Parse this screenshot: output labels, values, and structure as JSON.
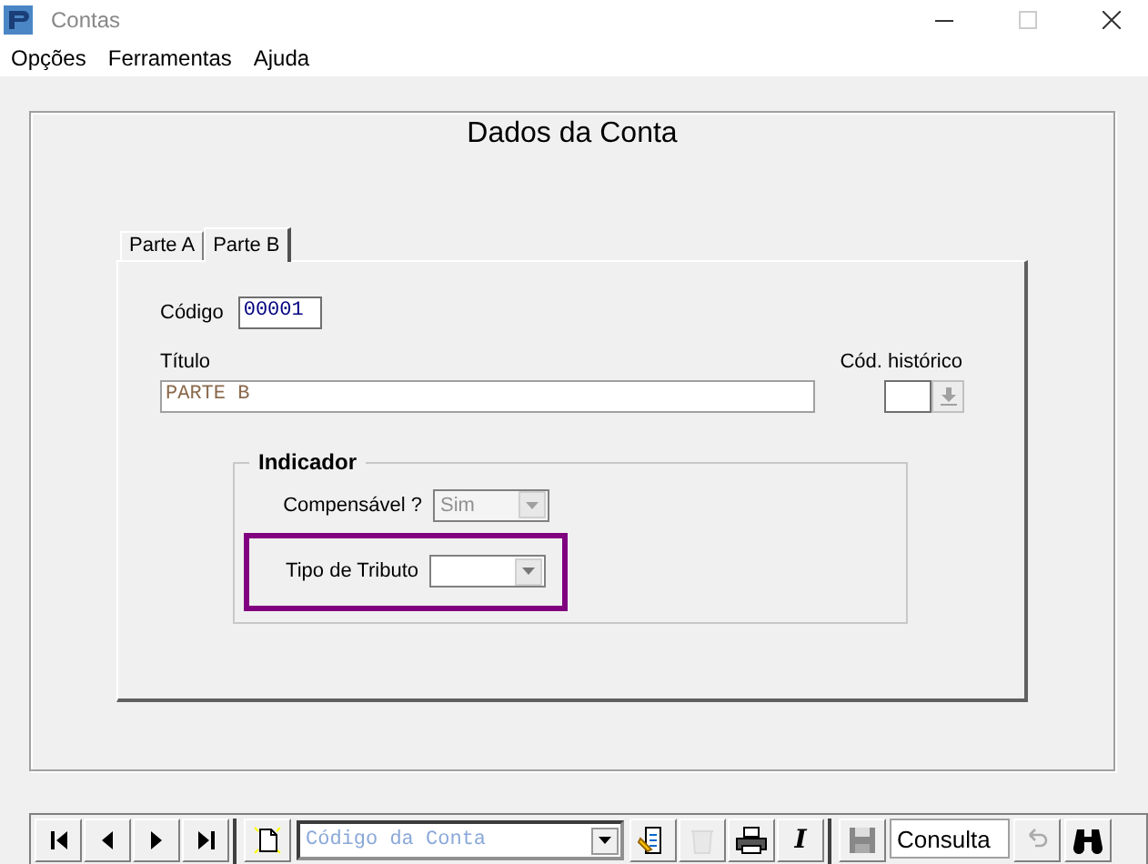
{
  "window": {
    "title": "Contas"
  },
  "menu": [
    "Opções",
    "Ferramentas",
    "Ajuda"
  ],
  "panel": {
    "title": "Dados da Conta"
  },
  "tabs": [
    {
      "label": "Parte A",
      "selected": false
    },
    {
      "label": "Parte B",
      "selected": true
    }
  ],
  "form": {
    "code": {
      "label": "Código",
      "value": "00001"
    },
    "title": {
      "label": "Título",
      "value": "PARTE B"
    },
    "history": {
      "label": "Cód. histórico",
      "disabled": true
    }
  },
  "indicator": {
    "title": "Indicador",
    "fields": [
      {
        "label": "Compensável ?",
        "value": "Sim",
        "disabled": true,
        "highlighted": false
      },
      {
        "label": "Tipo de Tributo",
        "disabled": false,
        "highlighted": true
      }
    ]
  },
  "toolbar": {
    "nav": [
      {
        "kind": "first"
      },
      {
        "kind": "prev"
      },
      {
        "kind": "next"
      },
      {
        "kind": "last"
      }
    ],
    "search_placeholder": "Código da Conta",
    "tools": [
      {
        "kind": "edit",
        "disabled": false
      },
      {
        "kind": "recycle",
        "disabled": true
      },
      {
        "kind": "print",
        "disabled": false
      },
      {
        "kind": "italic",
        "label": "I",
        "disabled": false
      }
    ],
    "save_disabled": true,
    "mode": "Consulta",
    "undo_disabled": true
  }
}
